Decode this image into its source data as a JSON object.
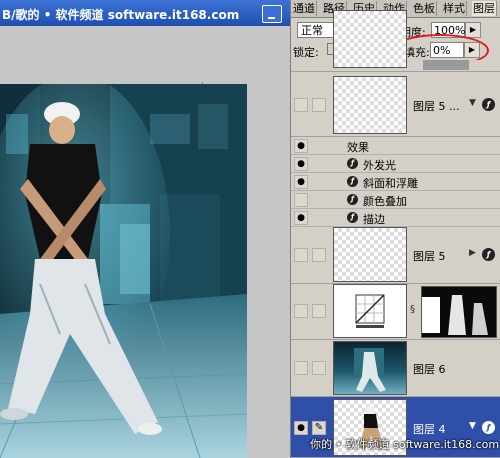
{
  "document": {
    "title": "B/歌的 • 软件频道  software.it168.com"
  },
  "panel": {
    "tabs": [
      "通道",
      "路径",
      "历史",
      "动作",
      "色板",
      "样式",
      "图层"
    ],
    "blend_mode": "正常",
    "opacity_label": "不透明度:",
    "opacity_value": "100%",
    "lock_label": "锁定:",
    "fill_label": "填充:",
    "fill_value": "0%"
  },
  "layers": {
    "layer_a": {
      "name": "图层 5 ..."
    },
    "effects_header": "效果",
    "effects": [
      "外发光",
      "斜面和浮雕",
      "颜色叠加",
      "描边"
    ],
    "layer_b": {
      "name": "图层 5"
    },
    "layer_d": {
      "name": "图层 6"
    },
    "layer_e": {
      "name": "图层 4"
    }
  },
  "watermark": "你的 • 软件频道 software.it168.com",
  "colors": {
    "annotation": "#e21a1a",
    "selection": "#2f4fa8",
    "titlebar": "#2a5cc4"
  }
}
